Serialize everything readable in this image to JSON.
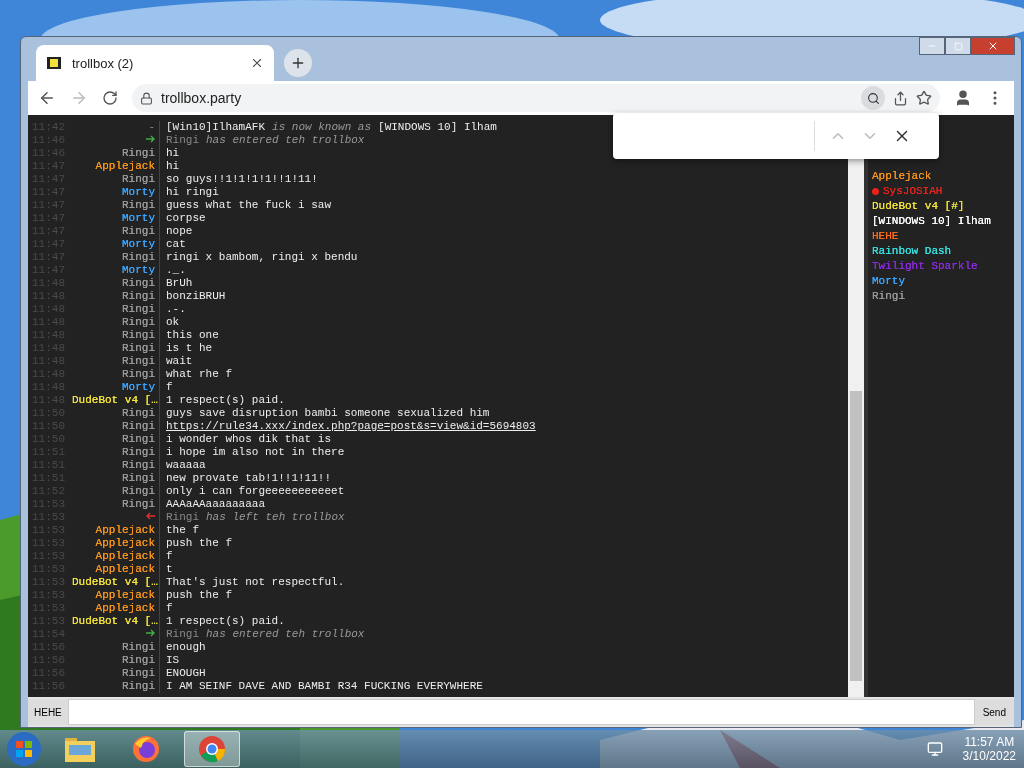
{
  "browser": {
    "tab": {
      "title": "trollbox (2)"
    },
    "url": "trollbox.party"
  },
  "messages": [
    {
      "kind": "rename",
      "time": "11:42",
      "nick": "-",
      "old": "[Win10]IlhamAFK",
      "action": "is now known as",
      "new": "[WINDOWS 10] Ilham"
    },
    {
      "kind": "enter",
      "time": "11:46",
      "nick": "Ringi",
      "action": "has entered teh trollbox"
    },
    {
      "kind": "msg",
      "time": "11:46",
      "nick": "Ringi",
      "color": "#9a9a9a",
      "text": "hi"
    },
    {
      "kind": "msg",
      "time": "11:47",
      "nick": "Applejack",
      "color": "#f7941d",
      "text": "hi"
    },
    {
      "kind": "msg",
      "time": "11:47",
      "nick": "Ringi",
      "color": "#9a9a9a",
      "text": "so guys!!1!1!1!1!!1!11!"
    },
    {
      "kind": "msg",
      "time": "11:47",
      "nick": "Morty",
      "color": "#3aa6ff",
      "text": "hi ringi"
    },
    {
      "kind": "msg",
      "time": "11:47",
      "nick": "Ringi",
      "color": "#9a9a9a",
      "text": "guess what the fuck i saw"
    },
    {
      "kind": "msg",
      "time": "11:47",
      "nick": "Morty",
      "color": "#3aa6ff",
      "text": "corpse"
    },
    {
      "kind": "msg",
      "time": "11:47",
      "nick": "Ringi",
      "color": "#9a9a9a",
      "text": "nope"
    },
    {
      "kind": "msg",
      "time": "11:47",
      "nick": "Morty",
      "color": "#3aa6ff",
      "text": "cat"
    },
    {
      "kind": "msg",
      "time": "11:47",
      "nick": "Ringi",
      "color": "#9a9a9a",
      "text": "ringi x bambom, ringi x bendu"
    },
    {
      "kind": "msg",
      "time": "11:47",
      "nick": "Morty",
      "color": "#3aa6ff",
      "text": "._."
    },
    {
      "kind": "msg",
      "time": "11:48",
      "nick": "Ringi",
      "color": "#9a9a9a",
      "text": "BrUh"
    },
    {
      "kind": "msg",
      "time": "11:48",
      "nick": "Ringi",
      "color": "#9a9a9a",
      "text": "bonziBRUH"
    },
    {
      "kind": "msg",
      "time": "11:48",
      "nick": "Ringi",
      "color": "#9a9a9a",
      "text": ".-."
    },
    {
      "kind": "msg",
      "time": "11:48",
      "nick": "Ringi",
      "color": "#9a9a9a",
      "text": "ok"
    },
    {
      "kind": "msg",
      "time": "11:48",
      "nick": "Ringi",
      "color": "#9a9a9a",
      "text": "this one"
    },
    {
      "kind": "msg",
      "time": "11:48",
      "nick": "Ringi",
      "color": "#9a9a9a",
      "text": "is t he"
    },
    {
      "kind": "msg",
      "time": "11:48",
      "nick": "Ringi",
      "color": "#9a9a9a",
      "text": "wait"
    },
    {
      "kind": "msg",
      "time": "11:48",
      "nick": "Ringi",
      "color": "#9a9a9a",
      "text": "what rhe f"
    },
    {
      "kind": "msg",
      "time": "11:48",
      "nick": "Morty",
      "color": "#3aa6ff",
      "text": "f"
    },
    {
      "kind": "msg",
      "time": "11:48",
      "nick": "DudeBot v4 […",
      "color": "#f2e23b",
      "text": "1 respect(s) paid."
    },
    {
      "kind": "msg",
      "time": "11:50",
      "nick": "Ringi",
      "color": "#9a9a9a",
      "text": "guys save disruption bambi someone sexualized him"
    },
    {
      "kind": "link",
      "time": "11:50",
      "nick": "Ringi",
      "color": "#9a9a9a",
      "text": "https://rule34.xxx/index.php?page=post&s=view&id=5694803"
    },
    {
      "kind": "msg",
      "time": "11:50",
      "nick": "Ringi",
      "color": "#9a9a9a",
      "text": "i wonder whos dik that is"
    },
    {
      "kind": "msg",
      "time": "11:51",
      "nick": "Ringi",
      "color": "#9a9a9a",
      "text": "i hope im also not in there"
    },
    {
      "kind": "msg",
      "time": "11:51",
      "nick": "Ringi",
      "color": "#9a9a9a",
      "text": "waaaaa"
    },
    {
      "kind": "msg",
      "time": "11:51",
      "nick": "Ringi",
      "color": "#9a9a9a",
      "text": "new provate tab!1!!1!11!!"
    },
    {
      "kind": "msg",
      "time": "11:52",
      "nick": "Ringi",
      "color": "#9a9a9a",
      "text": "only i can forgeeeeeeeeeeet"
    },
    {
      "kind": "msg",
      "time": "11:53",
      "nick": "Ringi",
      "color": "#9a9a9a",
      "text": "AAAaAAaaaaaaaaa"
    },
    {
      "kind": "leave",
      "time": "11:53",
      "nick": "Ringi",
      "action": "has left teh trollbox"
    },
    {
      "kind": "msg",
      "time": "11:53",
      "nick": "Applejack",
      "color": "#f7941d",
      "text": "the f"
    },
    {
      "kind": "msg",
      "time": "11:53",
      "nick": "Applejack",
      "color": "#f7941d",
      "text": "push the f"
    },
    {
      "kind": "msg",
      "time": "11:53",
      "nick": "Applejack",
      "color": "#f7941d",
      "text": "f"
    },
    {
      "kind": "msg",
      "time": "11:53",
      "nick": "Applejack",
      "color": "#f7941d",
      "text": "t"
    },
    {
      "kind": "msg",
      "time": "11:53",
      "nick": "DudeBot v4 […",
      "color": "#f2e23b",
      "text": "That's just not respectful."
    },
    {
      "kind": "msg",
      "time": "11:53",
      "nick": "Applejack",
      "color": "#f7941d",
      "text": "push the f"
    },
    {
      "kind": "msg",
      "time": "11:53",
      "nick": "Applejack",
      "color": "#f7941d",
      "text": "f"
    },
    {
      "kind": "msg",
      "time": "11:53",
      "nick": "DudeBot v4 […",
      "color": "#f2e23b",
      "text": "1 respect(s) paid."
    },
    {
      "kind": "enter",
      "time": "11:54",
      "nick": "Ringi",
      "action": "has entered teh trollbox"
    },
    {
      "kind": "msg",
      "time": "11:56",
      "nick": "Ringi",
      "color": "#9a9a9a",
      "text": "enough"
    },
    {
      "kind": "msg",
      "time": "11:56",
      "nick": "Ringi",
      "color": "#9a9a9a",
      "text": "IS"
    },
    {
      "kind": "msg",
      "time": "11:56",
      "nick": "Ringi",
      "color": "#9a9a9a",
      "text": "ENOUGH"
    },
    {
      "kind": "msg",
      "time": "11:56",
      "nick": "Ringi",
      "color": "#9a9a9a",
      "text": "I AM SEINF DAVE AND BAMBI R34 FUCKING EVERYWHERE"
    }
  ],
  "users": [
    {
      "name": "Applejack",
      "color": "#f7941d"
    },
    {
      "name": "SysJOSIAH",
      "color": "#e8221b",
      "kind": "admin"
    },
    {
      "name": "DudeBot v4 [#]",
      "color": "#f2e23b"
    },
    {
      "name": "[WINDOWS 10] Ilham",
      "color": "#ffffff"
    },
    {
      "name": "HEHE",
      "color": "#ff6a1a"
    },
    {
      "name": "Rainbow Dash",
      "color": "#33e0e0"
    },
    {
      "name": "Twilight Sparkle",
      "color": "#8a2be2"
    },
    {
      "name": "Morty",
      "color": "#3aa6ff"
    },
    {
      "name": "Ringi",
      "color": "#9a9a9a"
    }
  ],
  "input_bar": {
    "nick": "HEHE",
    "send": "Send"
  },
  "taskbar": {
    "time": "11:57 AM",
    "date": "3/10/2022",
    "apps": [
      {
        "kind": "folder",
        "selected": false
      },
      {
        "kind": "firefox",
        "selected": false
      },
      {
        "kind": "chrome",
        "selected": true
      }
    ]
  }
}
